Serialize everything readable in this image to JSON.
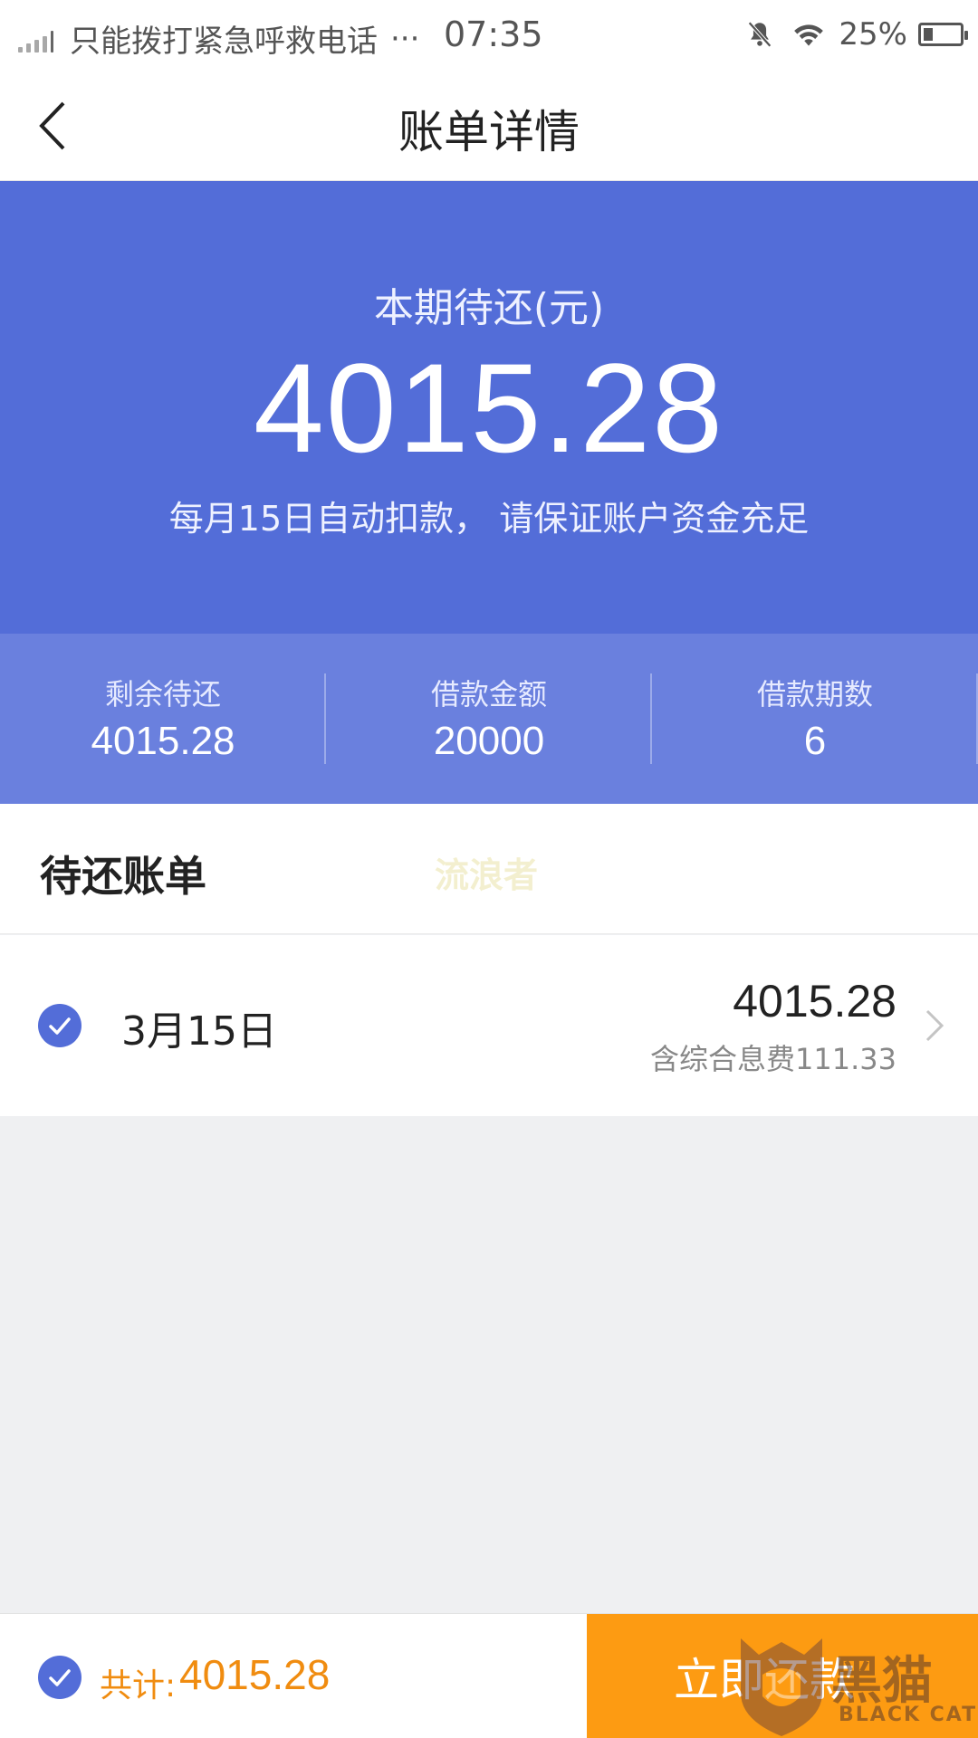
{
  "status_bar": {
    "carrier": "只能拨打紧急呼救电话",
    "more": "···",
    "time": "07:35",
    "battery": "25%",
    "icons": [
      "signal-icon",
      "mute-bell-icon",
      "wifi-icon",
      "battery-icon"
    ]
  },
  "nav": {
    "title": "账单详情",
    "back_icon": "chevron-left-icon"
  },
  "hero": {
    "label": "本期待还(元)",
    "amount": "4015.28",
    "note": "每月15日自动扣款， 请保证账户资金充足"
  },
  "stats": [
    {
      "label": "剩余待还",
      "value": "4015.28"
    },
    {
      "label": "借款金额",
      "value": "20000"
    },
    {
      "label": "借款期数",
      "value": "6"
    }
  ],
  "pending": {
    "title": "待还账单",
    "watermark": "流浪者",
    "items": [
      {
        "date": "3月15日",
        "amount": "4015.28",
        "fee": "含综合息费111.33",
        "checked": true
      }
    ]
  },
  "footer": {
    "total_label": "共计:",
    "total_value": "4015.28",
    "pay_label": "立即还款"
  },
  "brand": {
    "cn": "黑猫",
    "en": "BLACK CAT"
  },
  "colors": {
    "primary": "#536dd8",
    "stats_bg": "#6a80de",
    "accent": "#f08c10",
    "pay_button": "#fd9b12"
  }
}
